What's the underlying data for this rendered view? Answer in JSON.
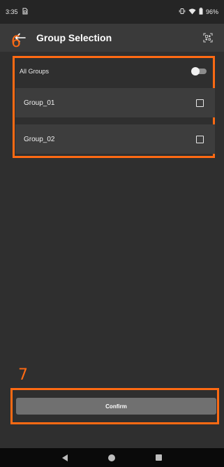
{
  "status_bar": {
    "time": "3:35",
    "notification_icon": "sim-card-icon",
    "battery_text": "96%",
    "icons": [
      "vibrate-icon",
      "wifi-icon",
      "battery-icon"
    ]
  },
  "app_bar": {
    "title": "Group Selection",
    "back_icon": "arrow-left-icon",
    "action_icon": "qr-scan-icon"
  },
  "annotations": {
    "marker_6": "6",
    "marker_7": "7",
    "color": "#ff6a13"
  },
  "group_list": {
    "all_groups_label": "All Groups",
    "all_groups_enabled": false,
    "groups": [
      {
        "label": "Group_01",
        "checked": false
      },
      {
        "label": "Group_02",
        "checked": false
      }
    ]
  },
  "footer": {
    "confirm_label": "Confirm"
  },
  "nav_bar": {
    "icons": [
      "back-triangle-icon",
      "home-circle-icon",
      "recents-square-icon"
    ]
  }
}
